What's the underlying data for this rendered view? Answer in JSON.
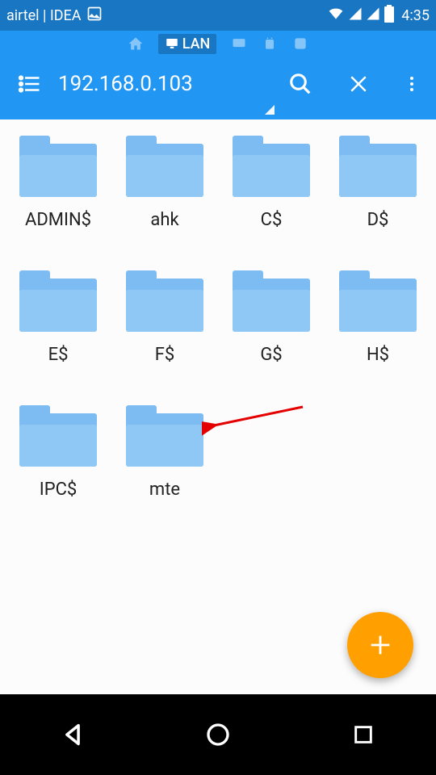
{
  "status": {
    "carrier": "airtel | IDEA",
    "time": "4:35"
  },
  "tabs": {
    "lan_label": "LAN"
  },
  "toolbar": {
    "path": "192.168.0.103"
  },
  "folders": [
    {
      "label": "ADMIN$"
    },
    {
      "label": "ahk"
    },
    {
      "label": "C$"
    },
    {
      "label": "D$"
    },
    {
      "label": "E$"
    },
    {
      "label": "F$"
    },
    {
      "label": "G$"
    },
    {
      "label": "H$"
    },
    {
      "label": "IPC$"
    },
    {
      "label": "mte"
    }
  ],
  "annotation": {
    "arrow_color": "#e40000",
    "target_index": 9
  },
  "fab": {
    "color": "#ffa000"
  }
}
